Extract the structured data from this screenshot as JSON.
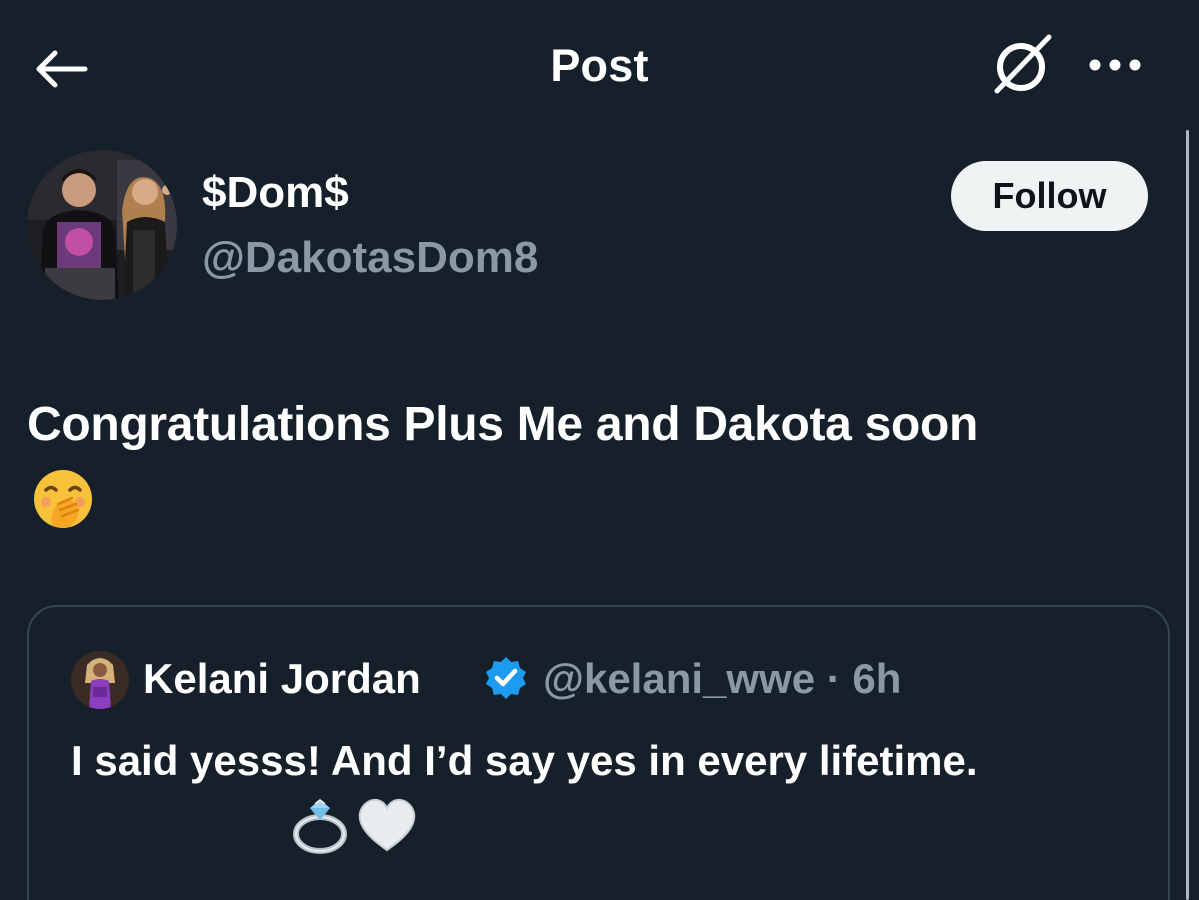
{
  "header": {
    "title": "Post",
    "back_icon": "arrow-left-icon",
    "grok_icon": "grok-icon",
    "more_icon": "more-horizontal-icon"
  },
  "post": {
    "author": {
      "display_name": "$Dom$",
      "handle": "@DakotasDom8"
    },
    "follow_label": "Follow",
    "text": "Congratulations Plus Me and Dakota soon",
    "emoji_icon": "face-with-hand-over-mouth-emoji"
  },
  "quoted_post": {
    "author_name": "Kelani Jordan",
    "verified": true,
    "handle_time": "@kelani_wwe · 6h",
    "text": "I said yesss! And I’d say yes in every lifetime.",
    "emoji_icons": [
      "ring-emoji",
      "white-heart-emoji"
    ]
  },
  "colors": {
    "background": "#15202b",
    "text_primary": "#ffffff",
    "text_secondary": "#8b98a5",
    "border": "#38444d",
    "follow_button_bg": "#eff3f4",
    "verified_blue": "#1d9bf0"
  }
}
